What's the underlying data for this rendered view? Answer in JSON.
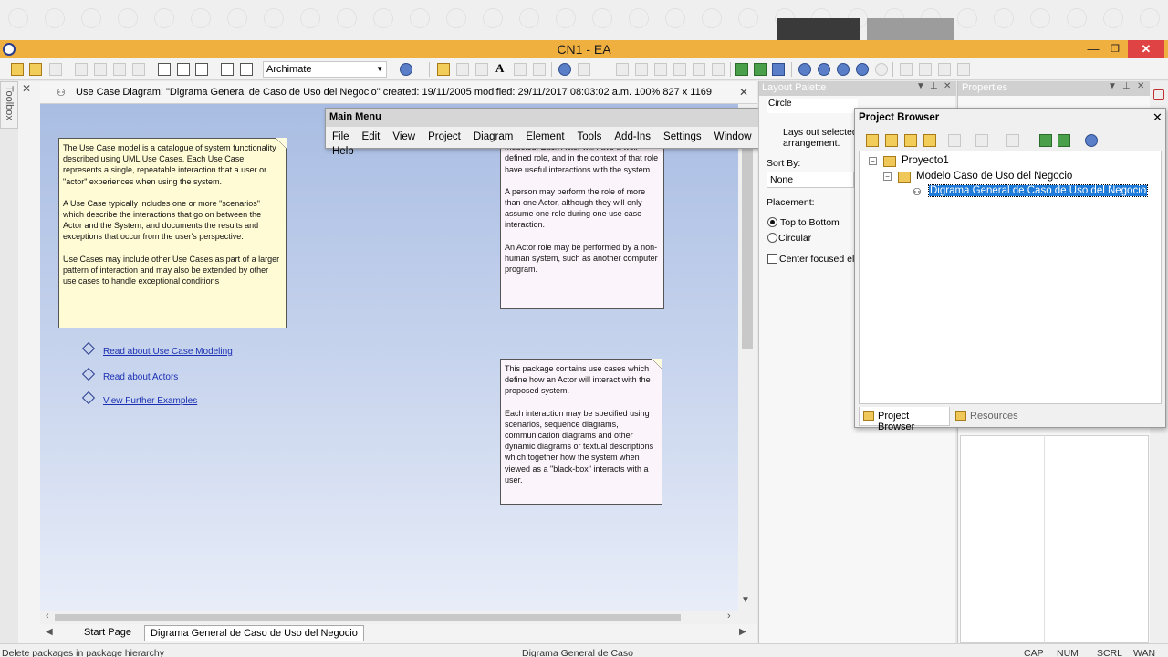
{
  "window": {
    "title": "CN1 - EA",
    "minimize": "—",
    "maximize": "❐",
    "close": "✕"
  },
  "toolbar": {
    "perspective": "Archimate"
  },
  "toolbox": {
    "label": "Toolbox"
  },
  "diagram_header": {
    "title": "Use Case Diagram: \"Digrama General de Caso de Uso del Negocio\"   created: 19/11/2005  modified: 29/11/2017 08:03:02 a.m.   100%   827 x 1169",
    "close": "✕"
  },
  "notes": {
    "usecase": [
      "The Use Case model is a catalogue of system functionality described using UML Use Cases. Each Use Case represents a single, repeatable interaction that a user or \"actor\" experiences when using the system.",
      "A Use Case typically includes one or more \"scenarios\" which describe the interactions that go on between the Actor and the System, and documents the results and exceptions that occur from the user's perspective.",
      "Use Cases may include other Use Cases as part of a larger pattern of interaction and may also be extended by other use cases to handle exceptional conditions"
    ],
    "actors": [
      "Actors are the users of the system being modeled. Each Actor will have a well-defined role, and in the context of that role have useful interactions with the system.",
      "A person may perform the role of more than one Actor, although they will only assume one role during one use case interaction.",
      "An Actor role may be performed by a non-human system, such as another computer program."
    ],
    "package": [
      "This package contains use cases which define how an Actor will interact with the proposed system.",
      "Each interaction may be specified using scenarios, sequence diagrams, communication diagrams and other dynamic diagrams or textual descriptions which together how the system when viewed as a \"black-box\" interacts with a user."
    ]
  },
  "links": [
    "Read about Use Case Modeling",
    "Read about Actors",
    "View Further Examples"
  ],
  "main_menu": {
    "title": "Main Menu",
    "items": [
      "File",
      "Edit",
      "View",
      "Project",
      "Diagram",
      "Element",
      "Tools",
      "Add-Ins",
      "Settings",
      "Window",
      "Help"
    ]
  },
  "layout_palette": {
    "title": "Layout Palette",
    "layout_type": "Circle",
    "description": "Lays out selected arrangement.",
    "sort_by_label": "Sort By:",
    "sort_by_value": "None",
    "placement_label": "Placement:",
    "option_top_to_bottom": "Top to Bottom",
    "option_circular": "Circular",
    "option_center_focused": "Center focused ele"
  },
  "properties": {
    "title": "Properties"
  },
  "project_browser": {
    "title": "Project Browser",
    "close": "✕",
    "tree": {
      "root": "Proyecto1",
      "package": "Modelo Caso de Uso del Negocio",
      "diagram": "Digrama General de Caso de Uso del Negocio"
    },
    "tabs": {
      "browser": "Project Browser",
      "resources": "Resources"
    }
  },
  "bottom_tabs": {
    "start": "Start Page",
    "diagram": "Digrama General de Caso de Uso del Negocio"
  },
  "statusbar": {
    "message": "Delete packages in package hierarchy",
    "diagram": "Digrama General de Caso",
    "caps": "CAP",
    "num": "NUM",
    "scrl": "SCRL",
    "wan": "WAN"
  }
}
